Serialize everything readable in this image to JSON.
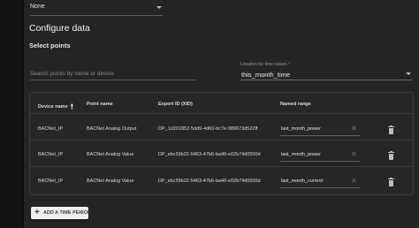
{
  "top_select": {
    "value": "None"
  },
  "headings": {
    "configure": "Configure data",
    "select_points": "Select points"
  },
  "search": {
    "placeholder": "Search points by name or device"
  },
  "location": {
    "label": "Location for time values *",
    "value": "this_month_time"
  },
  "table": {
    "headers": {
      "device": "Device name",
      "point": "Point name",
      "xid": "Export ID (XID)",
      "range": "Named range"
    },
    "rows": [
      {
        "device": "BACNet_IP",
        "point": "BACNet Analog Output",
        "xid": "DP_1d201852-5dd9-4d60-bc7e-989673d522ff",
        "range": "last_month_power"
      },
      {
        "device": "BACNet_IP",
        "point": "BACNet Analog Value",
        "xid": "DP_ebc59b22-5463-47b6-ba46-e02b74d0500d",
        "range": "last_month_power"
      },
      {
        "device": "BACNet_IP",
        "point": "BACNet Analog Value",
        "xid": "DP_ebc59b22-5463-47b6-ba46-e02b74d0500d",
        "range": "last_month_current"
      }
    ]
  },
  "add_button": {
    "label": "ADD A TIME PERIOD"
  }
}
